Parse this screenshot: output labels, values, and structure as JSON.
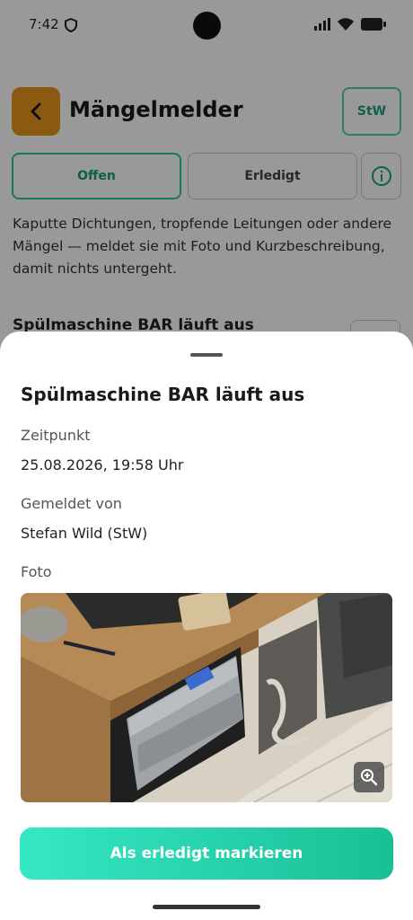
{
  "status_bar": {
    "time": "7:42"
  },
  "header": {
    "title": "Mängelmelder",
    "user_badge": "StW"
  },
  "tabs": [
    {
      "label": "Offen",
      "active": true
    },
    {
      "label": "Erledigt",
      "active": false
    }
  ],
  "description": "Kaputte Dichtungen, tropfende Leitungen oder andere Mängel — meldet sie mit Foto und Kurzbeschreibung, damit nichts untergeht.",
  "list": {
    "first_item_title": "Spülmaschine BAR läuft aus"
  },
  "sheet": {
    "title": "Spülmaschine BAR läuft aus",
    "time_label": "Zeitpunkt",
    "time_value": "25.08.2026, 19:58 Uhr",
    "reporter_label": "Gemeldet von",
    "reporter_value": "Stefan Wild (StW)",
    "photo_label": "Foto",
    "action_label": "Als erledigt markieren"
  },
  "colors": {
    "accent": "#e8951a",
    "primary": "#1abf95",
    "primary_light": "#35e8c4"
  },
  "icons": {
    "back": "chevron-left-icon",
    "info": "info-icon",
    "zoom": "zoom-in-icon",
    "status": [
      "shield-icon",
      "signal-icon",
      "wifi-icon",
      "battery-icon"
    ]
  }
}
